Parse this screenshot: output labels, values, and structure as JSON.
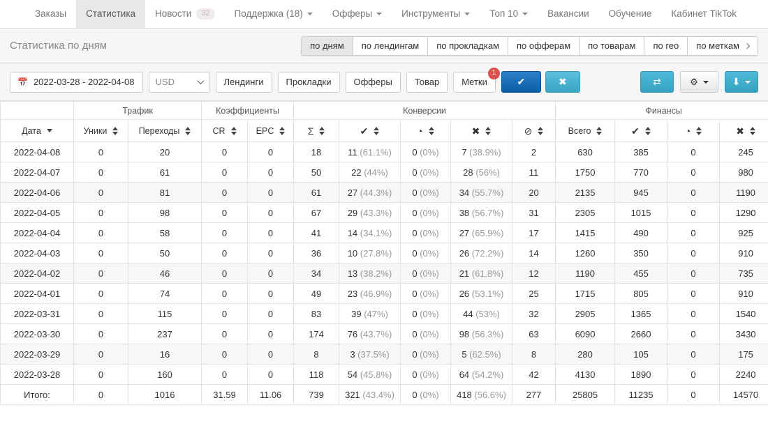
{
  "nav": {
    "items": [
      {
        "label": "Заказы",
        "active": false,
        "caret": false,
        "badge": null
      },
      {
        "label": "Статистика",
        "active": true,
        "caret": false,
        "badge": null
      },
      {
        "label": "Новости",
        "active": false,
        "caret": false,
        "badge": "32"
      },
      {
        "label": "Поддержка (18)",
        "active": false,
        "caret": true,
        "badge": null
      },
      {
        "label": "Офферы",
        "active": false,
        "caret": true,
        "badge": null
      },
      {
        "label": "Инструменты",
        "active": false,
        "caret": true,
        "badge": null
      },
      {
        "label": "Топ 10",
        "active": false,
        "caret": true,
        "badge": null
      },
      {
        "label": "Вакансии",
        "active": false,
        "caret": false,
        "badge": null
      },
      {
        "label": "Обучение",
        "active": false,
        "caret": false,
        "badge": null
      },
      {
        "label": "Кабинет TikTok",
        "active": false,
        "caret": false,
        "badge": null
      }
    ]
  },
  "subheader": {
    "title": "Статистика по дням",
    "tabs": [
      {
        "label": "по дням",
        "active": true
      },
      {
        "label": "по лендингам",
        "active": false
      },
      {
        "label": "по прокладкам",
        "active": false
      },
      {
        "label": "по офферам",
        "active": false
      },
      {
        "label": "по товарам",
        "active": false
      },
      {
        "label": "по гео",
        "active": false
      },
      {
        "label": "по меткам",
        "active": false
      }
    ]
  },
  "toolbar": {
    "date_range": "2022-03-28 - 2022-04-08",
    "currency": "USD",
    "currency_options": [
      "USD"
    ],
    "filters": [
      {
        "label": "Лендинги",
        "badge": null
      },
      {
        "label": "Прокладки",
        "badge": null
      },
      {
        "label": "Офферы",
        "badge": null
      },
      {
        "label": "Товар",
        "badge": null
      },
      {
        "label": "Метки",
        "badge": "1"
      }
    ],
    "apply_icon": "check-icon",
    "reset_icon": "close-icon",
    "shuffle_icon": "shuffle-icon",
    "settings_icon": "gear-icon",
    "export_icon": "download-icon",
    "colors": {
      "primary": "#0b5fa5",
      "info": "#38a5c3",
      "badge": "#d9534f"
    }
  },
  "table": {
    "groups": [
      {
        "label": "",
        "span": 1
      },
      {
        "label": "Трафик",
        "span": 2
      },
      {
        "label": "Коэффициенты",
        "span": 2
      },
      {
        "label": "Конверсии",
        "span": 5
      },
      {
        "label": "Финансы",
        "span": 4
      }
    ],
    "columns": [
      {
        "label": "Дата",
        "icon": null,
        "sort": "single"
      },
      {
        "label": "Уники",
        "icon": null,
        "sort": "both"
      },
      {
        "label": "Переходы",
        "icon": null,
        "sort": "both"
      },
      {
        "label": "CR",
        "icon": null,
        "sort": "both"
      },
      {
        "label": "EPC",
        "icon": null,
        "sort": "both"
      },
      {
        "label": "Σ",
        "icon": "sigma-icon",
        "sort": "both"
      },
      {
        "label": "✔",
        "icon": "check-icon",
        "sort": "both"
      },
      {
        "label": "◔",
        "icon": "clock-icon",
        "sort": "both"
      },
      {
        "label": "✖",
        "icon": "cross-icon",
        "sort": "both"
      },
      {
        "label": "⊘",
        "icon": "ban-icon",
        "sort": "both"
      },
      {
        "label": "Всего",
        "icon": null,
        "sort": "both"
      },
      {
        "label": "✔",
        "icon": "check-icon",
        "sort": "both"
      },
      {
        "label": "◔",
        "icon": "clock-icon",
        "sort": "both"
      },
      {
        "label": "✖",
        "icon": "cross-icon",
        "sort": "both"
      }
    ],
    "rows": [
      {
        "date": "2022-04-08",
        "uniq": "0",
        "clicks": "20",
        "cr": "0",
        "epc": "0",
        "sum": "18",
        "approved": "11",
        "approved_pct": "(61.1%)",
        "hold": "0",
        "hold_pct": "(0%)",
        "rejected": "7",
        "rejected_pct": "(38.9%)",
        "trash": "2",
        "total": "630",
        "fin_ok": "385",
        "fin_hold": "0",
        "fin_bad": "245"
      },
      {
        "date": "2022-04-07",
        "uniq": "0",
        "clicks": "61",
        "cr": "0",
        "epc": "0",
        "sum": "50",
        "approved": "22",
        "approved_pct": "(44%)",
        "hold": "0",
        "hold_pct": "(0%)",
        "rejected": "28",
        "rejected_pct": "(56%)",
        "trash": "11",
        "total": "1750",
        "fin_ok": "770",
        "fin_hold": "0",
        "fin_bad": "980"
      },
      {
        "date": "2022-04-06",
        "uniq": "0",
        "clicks": "81",
        "cr": "0",
        "epc": "0",
        "sum": "61",
        "approved": "27",
        "approved_pct": "(44.3%)",
        "hold": "0",
        "hold_pct": "(0%)",
        "rejected": "34",
        "rejected_pct": "(55.7%)",
        "trash": "20",
        "total": "2135",
        "fin_ok": "945",
        "fin_hold": "0",
        "fin_bad": "1190"
      },
      {
        "date": "2022-04-05",
        "uniq": "0",
        "clicks": "98",
        "cr": "0",
        "epc": "0",
        "sum": "67",
        "approved": "29",
        "approved_pct": "(43.3%)",
        "hold": "0",
        "hold_pct": "(0%)",
        "rejected": "38",
        "rejected_pct": "(56.7%)",
        "trash": "31",
        "total": "2305",
        "fin_ok": "1015",
        "fin_hold": "0",
        "fin_bad": "1290"
      },
      {
        "date": "2022-04-04",
        "uniq": "0",
        "clicks": "58",
        "cr": "0",
        "epc": "0",
        "sum": "41",
        "approved": "14",
        "approved_pct": "(34.1%)",
        "hold": "0",
        "hold_pct": "(0%)",
        "rejected": "27",
        "rejected_pct": "(65.9%)",
        "trash": "17",
        "total": "1415",
        "fin_ok": "490",
        "fin_hold": "0",
        "fin_bad": "925"
      },
      {
        "date": "2022-04-03",
        "uniq": "0",
        "clicks": "50",
        "cr": "0",
        "epc": "0",
        "sum": "36",
        "approved": "10",
        "approved_pct": "(27.8%)",
        "hold": "0",
        "hold_pct": "(0%)",
        "rejected": "26",
        "rejected_pct": "(72.2%)",
        "trash": "14",
        "total": "1260",
        "fin_ok": "350",
        "fin_hold": "0",
        "fin_bad": "910"
      },
      {
        "date": "2022-04-02",
        "uniq": "0",
        "clicks": "46",
        "cr": "0",
        "epc": "0",
        "sum": "34",
        "approved": "13",
        "approved_pct": "(38.2%)",
        "hold": "0",
        "hold_pct": "(0%)",
        "rejected": "21",
        "rejected_pct": "(61.8%)",
        "trash": "12",
        "total": "1190",
        "fin_ok": "455",
        "fin_hold": "0",
        "fin_bad": "735"
      },
      {
        "date": "2022-04-01",
        "uniq": "0",
        "clicks": "74",
        "cr": "0",
        "epc": "0",
        "sum": "49",
        "approved": "23",
        "approved_pct": "(46.9%)",
        "hold": "0",
        "hold_pct": "(0%)",
        "rejected": "26",
        "rejected_pct": "(53.1%)",
        "trash": "25",
        "total": "1715",
        "fin_ok": "805",
        "fin_hold": "0",
        "fin_bad": "910"
      },
      {
        "date": "2022-03-31",
        "uniq": "0",
        "clicks": "115",
        "cr": "0",
        "epc": "0",
        "sum": "83",
        "approved": "39",
        "approved_pct": "(47%)",
        "hold": "0",
        "hold_pct": "(0%)",
        "rejected": "44",
        "rejected_pct": "(53%)",
        "trash": "32",
        "total": "2905",
        "fin_ok": "1365",
        "fin_hold": "0",
        "fin_bad": "1540"
      },
      {
        "date": "2022-03-30",
        "uniq": "0",
        "clicks": "237",
        "cr": "0",
        "epc": "0",
        "sum": "174",
        "approved": "76",
        "approved_pct": "(43.7%)",
        "hold": "0",
        "hold_pct": "(0%)",
        "rejected": "98",
        "rejected_pct": "(56.3%)",
        "trash": "63",
        "total": "6090",
        "fin_ok": "2660",
        "fin_hold": "0",
        "fin_bad": "3430"
      },
      {
        "date": "2022-03-29",
        "uniq": "0",
        "clicks": "16",
        "cr": "0",
        "epc": "0",
        "sum": "8",
        "approved": "3",
        "approved_pct": "(37.5%)",
        "hold": "0",
        "hold_pct": "(0%)",
        "rejected": "5",
        "rejected_pct": "(62.5%)",
        "trash": "8",
        "total": "280",
        "fin_ok": "105",
        "fin_hold": "0",
        "fin_bad": "175"
      },
      {
        "date": "2022-03-28",
        "uniq": "0",
        "clicks": "160",
        "cr": "0",
        "epc": "0",
        "sum": "118",
        "approved": "54",
        "approved_pct": "(45.8%)",
        "hold": "0",
        "hold_pct": "(0%)",
        "rejected": "64",
        "rejected_pct": "(54.2%)",
        "trash": "42",
        "total": "4130",
        "fin_ok": "1890",
        "fin_hold": "0",
        "fin_bad": "2240"
      }
    ],
    "total_row": {
      "date": "Итого:",
      "uniq": "0",
      "clicks": "1016",
      "cr": "31.59",
      "epc": "11.06",
      "sum": "739",
      "approved": "321",
      "approved_pct": "(43.4%)",
      "hold": "0",
      "hold_pct": "(0%)",
      "rejected": "418",
      "rejected_pct": "(56.6%)",
      "trash": "277",
      "total": "25805",
      "fin_ok": "11235",
      "fin_hold": "0",
      "fin_bad": "14570"
    }
  }
}
